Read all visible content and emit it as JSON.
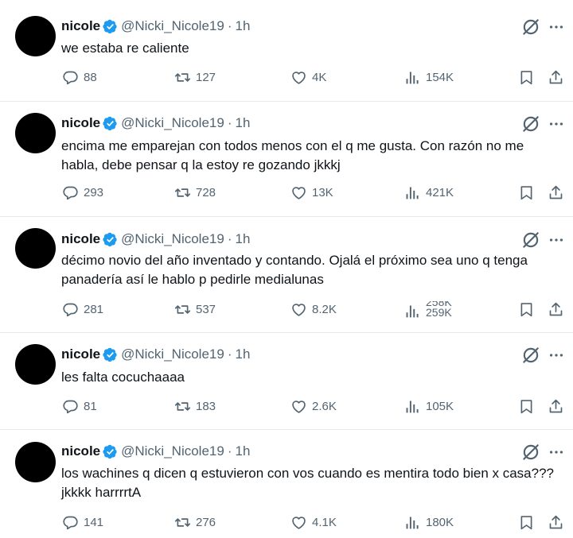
{
  "tweets": [
    {
      "name": "nicole",
      "handle": "@Nicki_Nicole19",
      "dot": "·",
      "time": "1h",
      "text": "we estaba re caliente",
      "replies": "88",
      "retweets": "127",
      "likes": "4K",
      "views": "154K"
    },
    {
      "name": "nicole",
      "handle": "@Nicki_Nicole19",
      "dot": "·",
      "time": "1h",
      "text": "encima me emparejan con todos menos con el q me gusta. Con razón no me habla, debe pensar q la estoy re gozando jkkkj",
      "replies": "293",
      "retweets": "728",
      "likes": "13K",
      "views": "421K"
    },
    {
      "name": "nicole",
      "handle": "@Nicki_Nicole19",
      "dot": "·",
      "time": "1h",
      "text": "décimo novio del año inventado y contando. Ojalá el próximo sea uno q tenga panadería así le hablo p pedirle medialunas",
      "replies": "281",
      "retweets": "537",
      "likes": "8.2K",
      "views_old": "258K",
      "views": "259K"
    },
    {
      "name": "nicole",
      "handle": "@Nicki_Nicole19",
      "dot": "·",
      "time": "1h",
      "text": "les falta cocuchaaaa",
      "replies": "81",
      "retweets": "183",
      "likes": "2.6K",
      "views": "105K"
    },
    {
      "name": "nicole",
      "handle": "@Nicki_Nicole19",
      "dot": "·",
      "time": "1h",
      "text": "los wachines q dicen q estuvieron con vos cuando es mentira todo bien x casa??? jkkkk harrrrtA",
      "replies": "141",
      "retweets": "276",
      "likes": "4.1K",
      "views": "180K"
    }
  ],
  "icons": {
    "verified": "verified-badge-icon",
    "grok": "grok-icon",
    "more": "more-icon",
    "reply": "reply-icon",
    "retweet": "retweet-icon",
    "like": "like-icon",
    "views": "views-icon",
    "bookmark": "bookmark-icon",
    "share": "share-icon"
  },
  "colors": {
    "verified": "#1d9bf0",
    "secondary_text": "#536471",
    "primary_text": "#0f1419",
    "divider": "#e7e9ea"
  }
}
